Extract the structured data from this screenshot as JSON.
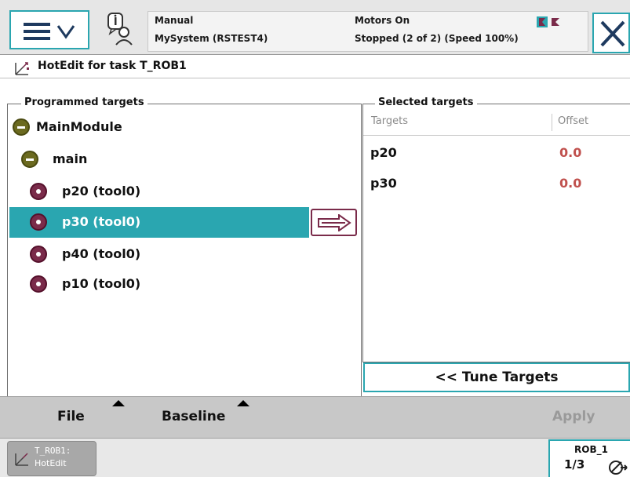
{
  "header": {
    "mode": "Manual",
    "system": "MySystem (RSTEST4)",
    "motors": "Motors On",
    "state": "Stopped (2 of 2) (Speed 100%)"
  },
  "window": {
    "title": "HotEdit for task T_ROB1"
  },
  "programmed": {
    "legend": "Programmed targets",
    "module": "MainModule",
    "routine": "main",
    "targets": [
      "p20 (tool0)",
      "p30 (tool0)",
      "p40 (tool0)",
      "p10 (tool0)"
    ],
    "selected_index": 1
  },
  "selected": {
    "legend": "Selected targets",
    "col_targets": "Targets",
    "col_offset": "Offset",
    "rows": [
      {
        "name": "p20",
        "offset": "0.0"
      },
      {
        "name": "p30",
        "offset": "0.0"
      }
    ],
    "tune_button": "<< Tune Targets"
  },
  "commands": {
    "file": "File",
    "baseline": "Baseline",
    "apply": "Apply"
  },
  "taskbar": {
    "task_line1": "T_ROB1:",
    "task_line2": "HotEdit",
    "robot": "ROB_1",
    "fraction": "1/3"
  },
  "colors": {
    "accent": "#2aa6b0",
    "selection": "#2aa6b0",
    "offset_value": "#c0504d",
    "module_icon": "#6b6a1f",
    "target_icon": "#7a2b4a"
  }
}
